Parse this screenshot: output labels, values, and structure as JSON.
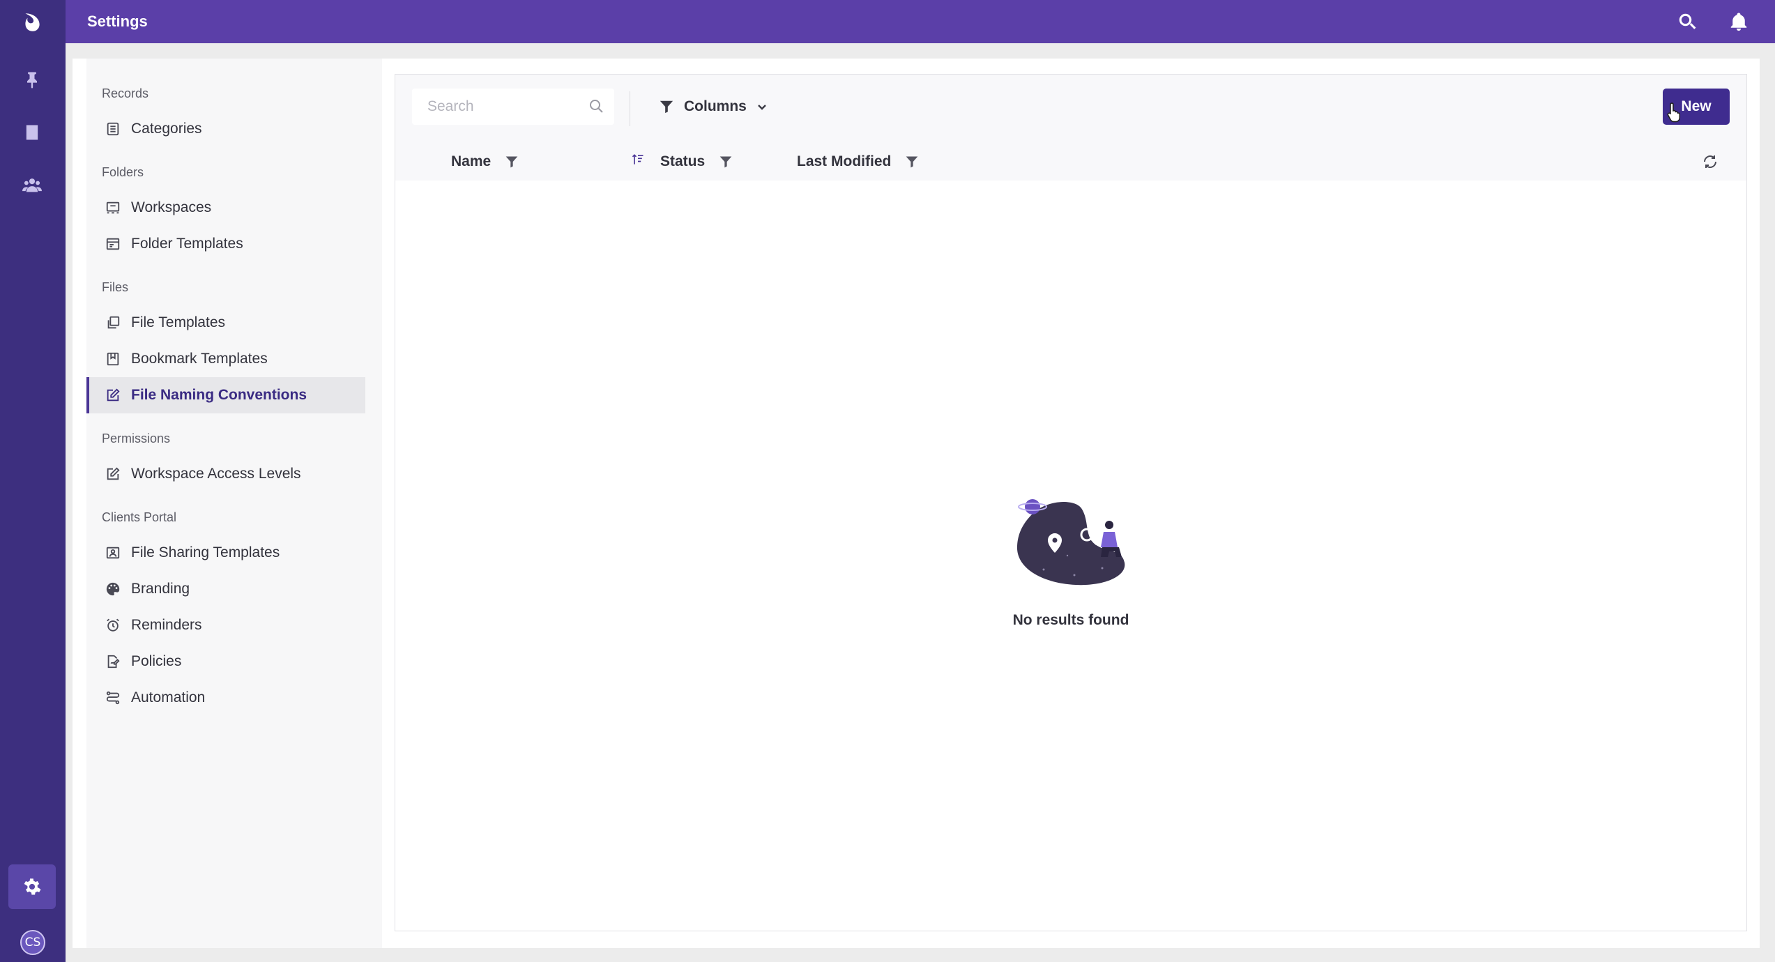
{
  "topbar": {
    "title": "Settings",
    "search_icon": "search-icon",
    "notifications_icon": "bell-icon"
  },
  "rail": {
    "items": [
      "logo-icon",
      "pin-icon",
      "records-icon",
      "users-icon",
      "gear-icon"
    ],
    "avatar_initials": "CS"
  },
  "nav": {
    "sections": [
      {
        "title": "Records",
        "items": [
          {
            "label": "Categories",
            "icon": "categories-icon"
          }
        ]
      },
      {
        "title": "Folders",
        "items": [
          {
            "label": "Workspaces",
            "icon": "workspaces-icon"
          },
          {
            "label": "Folder Templates",
            "icon": "folder-templates-icon"
          }
        ]
      },
      {
        "title": "Files",
        "items": [
          {
            "label": "File Templates",
            "icon": "file-templates-icon"
          },
          {
            "label": "Bookmark Templates",
            "icon": "bookmark-icon"
          },
          {
            "label": "File Naming Conventions",
            "icon": "edit-icon",
            "active": true
          }
        ]
      },
      {
        "title": "Permissions",
        "items": [
          {
            "label": "Workspace Access Levels",
            "icon": "edit-icon"
          }
        ]
      },
      {
        "title": "Clients Portal",
        "items": [
          {
            "label": "File Sharing Templates",
            "icon": "image-icon"
          },
          {
            "label": "Branding",
            "icon": "palette-icon"
          },
          {
            "label": "Reminders",
            "icon": "alarm-icon"
          },
          {
            "label": "Policies",
            "icon": "policy-icon"
          },
          {
            "label": "Automation",
            "icon": "automation-icon"
          }
        ]
      }
    ]
  },
  "toolbar": {
    "search_placeholder": "Search",
    "columns_label": "Columns",
    "new_label": "New"
  },
  "table": {
    "columns": [
      "Name",
      "Status",
      "Last Modified"
    ]
  },
  "empty_state": {
    "message": "No results found"
  },
  "colors": {
    "rail": "#3d2f7f",
    "topbar": "#5b3fa8",
    "accent": "#3f2c8f"
  }
}
